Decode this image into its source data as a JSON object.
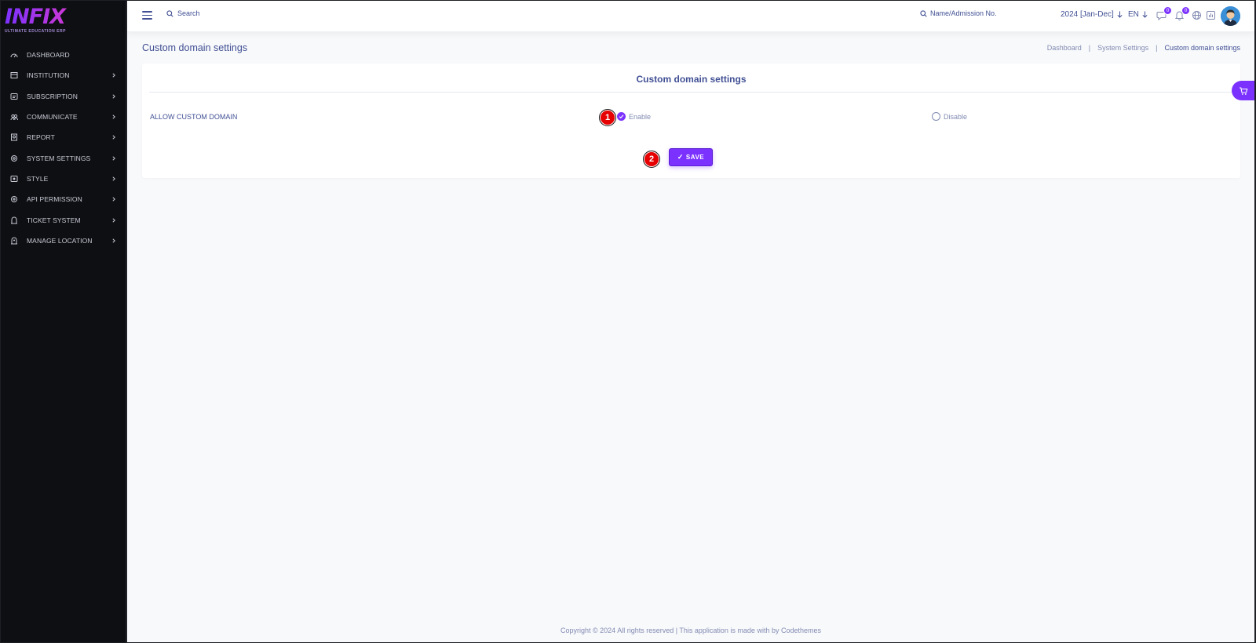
{
  "brand": {
    "logo_text": "INFIX",
    "tagline": "ULTIMATE EDUCATION ERP"
  },
  "sidebar": {
    "items": [
      {
        "label": "DASHBOARD",
        "icon": "dashboard-icon",
        "has_children": false
      },
      {
        "label": "INSTITUTION",
        "icon": "institution-icon",
        "has_children": true
      },
      {
        "label": "SUBSCRIPTION",
        "icon": "subscription-icon",
        "has_children": true
      },
      {
        "label": "COMMUNICATE",
        "icon": "communicate-icon",
        "has_children": true
      },
      {
        "label": "REPORT",
        "icon": "report-icon",
        "has_children": true
      },
      {
        "label": "SYSTEM SETTINGS",
        "icon": "settings-icon",
        "has_children": true
      },
      {
        "label": "STYLE",
        "icon": "style-icon",
        "has_children": true
      },
      {
        "label": "API PERMISSION",
        "icon": "api-icon",
        "has_children": true
      },
      {
        "label": "TICKET SYSTEM",
        "icon": "ticket-icon",
        "has_children": true
      },
      {
        "label": "MANAGE LOCATION",
        "icon": "location-icon",
        "has_children": true
      }
    ]
  },
  "header": {
    "search_placeholder": "Search",
    "student_search_placeholder": "Name/Admission No.",
    "session": "2024 [Jan-Dec]",
    "language": "EN",
    "messages_count": "0",
    "notifications_count": "0"
  },
  "page": {
    "title": "Custom domain settings",
    "breadcrumb": [
      "Dashboard",
      "System Settings",
      "Custom domain settings"
    ]
  },
  "card": {
    "title": "Custom domain settings",
    "row_label": "ALLOW CUSTOM DOMAIN",
    "enable_label": "Enable",
    "disable_label": "Disable",
    "selected": "enable",
    "save_label": "SAVE"
  },
  "annotations": {
    "step1": "1",
    "step2": "2"
  },
  "footer": {
    "text": "Copyright © 2024 All rights reserved | This application is made with by Codethemes"
  },
  "colors": {
    "accent": "#7c32ff",
    "sidebar_bg": "#0e0f13",
    "text_primary": "#415094",
    "text_muted": "#828bb2",
    "marker_red": "#e60000"
  }
}
